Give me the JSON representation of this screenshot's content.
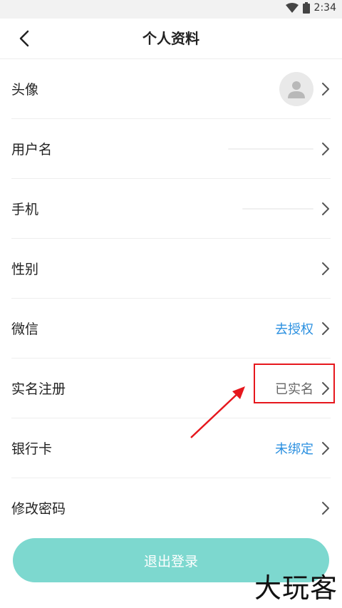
{
  "status_bar": {
    "time": "2:34",
    "icons": [
      "wifi-icon",
      "battery-icon"
    ]
  },
  "header": {
    "title": "个人资料",
    "back_icon": "chevron-left-icon"
  },
  "rows": [
    {
      "label": "头像",
      "value": "",
      "kind": "avatar"
    },
    {
      "label": "用户名",
      "value": "",
      "kind": "blurred"
    },
    {
      "label": "手机",
      "value": "",
      "kind": "blurred"
    },
    {
      "label": "性别",
      "value": "",
      "kind": "none"
    },
    {
      "label": "微信",
      "value": "去授权",
      "kind": "link"
    },
    {
      "label": "实名注册",
      "value": "已实名",
      "kind": "plain"
    },
    {
      "label": "银行卡",
      "value": "未绑定",
      "kind": "link"
    },
    {
      "label": "修改密码",
      "value": "",
      "kind": "none"
    }
  ],
  "logout": {
    "label": "退出登录"
  },
  "watermark": "大玩客",
  "colors": {
    "link": "#2b90e0",
    "logout_bg": "#7dd8cf",
    "highlight": "#e6171d"
  }
}
